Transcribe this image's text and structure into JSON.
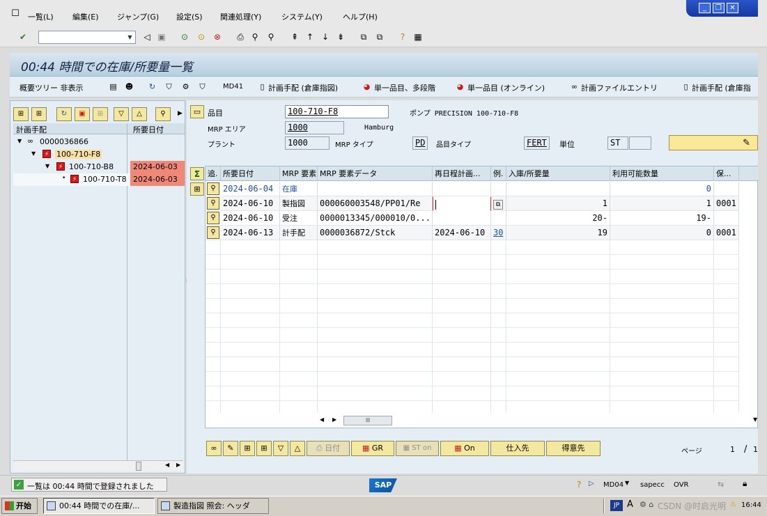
{
  "menubar": {
    "items": [
      "一覧(L)",
      "編集(E)",
      "ジャンプ(G)",
      "設定(S)",
      "関連処理(Y)",
      "システム(Y)",
      "ヘルプ(H)"
    ]
  },
  "window_controls": {
    "minimize": "_",
    "restore": "❐",
    "close": "✕"
  },
  "command_field": {
    "value": ""
  },
  "title": "00:44 時間での在庫/所要量一覧",
  "app_toolbar": {
    "hide_tree": "概要ツリー 非表示",
    "md41": "MD41",
    "plan_order": "計画手配 (倉庫指図)",
    "single_item_multilevel": "単一品目、多段階",
    "single_item_online": "単一品目 (オンライン)",
    "plan_file_entry": "計画ファイルエントリ",
    "plan_order2": "計画手配 (倉庫指"
  },
  "tree": {
    "col1": "計画手配",
    "col2": "所要日付",
    "rows": [
      {
        "label": "0000036866",
        "date": ""
      },
      {
        "label": "100-710-F8",
        "date": ""
      },
      {
        "label": "100-710-B8",
        "date": "2024-06-03"
      },
      {
        "label": "100-710-T8",
        "date": "2024-06-03"
      }
    ]
  },
  "header": {
    "material_label": "品目",
    "material": "100-710-F8",
    "material_desc": "ポンプ PRECISION 100-710-F8",
    "mrp_area_label": "MRP エリア",
    "mrp_area": "1000",
    "mrp_area_desc": "Hamburg",
    "plant_label": "プラント",
    "plant": "1000",
    "mrp_type_label": "MRP タイプ",
    "mrp_type": "PD",
    "mat_type_label": "品目タイプ",
    "mat_type": "FERT",
    "unit_label": "単位",
    "unit": "ST"
  },
  "grid": {
    "columns": [
      "追.",
      "所要日付",
      "MRP 要素",
      "MRP 要素データ",
      "再日程計画...",
      "例.",
      "入庫/所要量",
      "利用可能数量",
      "保..."
    ],
    "rows": [
      {
        "date": "2024-06-04",
        "elem": "在庫",
        "data": "",
        "resched": "",
        "exc": "",
        "qty": "",
        "avail": "0",
        "stor": ""
      },
      {
        "date": "2024-06-10",
        "elem": "製指図",
        "data": "000060003548/PP01/Re",
        "resched": "",
        "exc": "",
        "qty": "1",
        "avail": "1",
        "stor": "0001"
      },
      {
        "date": "2024-06-10",
        "elem": "受注",
        "data": "0000013345/000010/0...",
        "resched": "",
        "exc": "",
        "qty": "20-",
        "avail": "19-",
        "stor": ""
      },
      {
        "date": "2024-06-13",
        "elem": "計手配",
        "data": "0000036872/Stck",
        "resched": "2024-06-10",
        "exc": "30",
        "qty": "19",
        "avail": "0",
        "stor": "0001"
      }
    ]
  },
  "bottom_toolbar": {
    "date_btn": "日付",
    "gr_btn": "GR",
    "st_on": "ST on",
    "on_btn": "On",
    "vendor_btn": "仕入先",
    "customer_btn": "得意先",
    "page_label": "ページ",
    "page_current": "1",
    "page_sep": "/",
    "page_total": "1"
  },
  "status": {
    "message": "一覧は 00:44 時間で登録されました",
    "tcode": "MD04",
    "server": "sapecc",
    "mode": "OVR"
  },
  "taskbar": {
    "start": "开始",
    "task1": "00:44 時間での在庫/...",
    "task2": "製造指図 照会: ヘッダ",
    "clock": "16:44",
    "watermark": "CSDN @时启光明",
    "ime": "JP"
  },
  "colors": {
    "title_bg": "#c8dbea",
    "highlight_red": "#f08878",
    "button_yellow": "#f4e8a0",
    "link_blue": "#1a4fa0"
  }
}
